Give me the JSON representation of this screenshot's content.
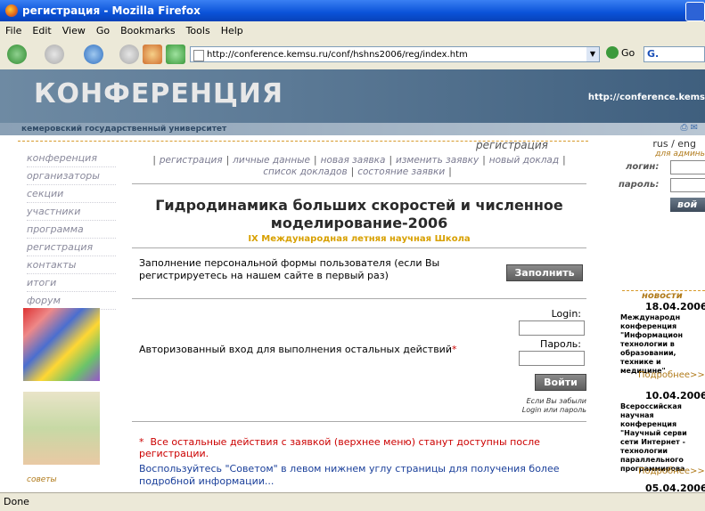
{
  "window": {
    "title": "регистрация - Mozilla Firefox"
  },
  "menu": [
    "File",
    "Edit",
    "View",
    "Go",
    "Bookmarks",
    "Tools",
    "Help"
  ],
  "address": {
    "url": "http://conference.kemsu.ru/conf/hshns2006/reg/index.htm",
    "go_label": "Go",
    "search_value": "G."
  },
  "site": {
    "logo": "КОНФЕРЕНЦИЯ",
    "university": "кемеровский государственный университет",
    "banner_url": "http://conference.kems",
    "lang": "rus / eng",
    "section_title": "регистрация"
  },
  "sidebar": {
    "items": [
      "конференция",
      "организаторы",
      "секции",
      "участники",
      "программа",
      "регистрация",
      "контакты",
      "итоги",
      "форум"
    ],
    "bottom": "советы"
  },
  "topmenu": {
    "items": [
      "регистрация",
      "личные данные",
      "новая заявка",
      "изменить заявку",
      "новый доклад",
      "список докладов",
      "состояние заявки"
    ]
  },
  "main": {
    "title": "Гидродинамика больших скоростей и численное моделирование-2006",
    "subtitle": "IX Международная летняя научная Школа",
    "fill_text": "Заполнение персональной формы пользователя (если Вы регистрируетесь на нашем сайте в первый раз)",
    "fill_button": "Заполнить",
    "auth_text": "Авторизованный вход для выполнения остальных действий",
    "auth_star": "*",
    "login_label": "Login:",
    "password_label": "Пароль:",
    "login_button": "Войти",
    "forgot1": "Если Вы забыли",
    "forgot2": "Login или пароль",
    "note_star": "*",
    "note": "Все остальные действия с заявкой (верхнее меню) станут доступны после регистрации.",
    "note2": "Воспользуйтесь \"Советом\" в левом нижнем углу страницы для получения более подробной информации..."
  },
  "right": {
    "admin_label": "для админь",
    "login_label": "логин:",
    "password_label": "пароль:",
    "login_button": "вой",
    "news_label": "новости",
    "news": [
      {
        "date": "18.04.2006",
        "text": "Международн конференция \"Информацион технологии в образовании, технике и медицине\"",
        "more": "Подробнее>>"
      },
      {
        "date": "10.04.2006",
        "text": "Всероссийская научная конференция \"Научный серви сети Интернет - технологии параллельного программирова",
        "more": "Подробнее>>"
      },
      {
        "date": "05.04.2006"
      }
    ]
  },
  "status": {
    "text": "Done"
  }
}
